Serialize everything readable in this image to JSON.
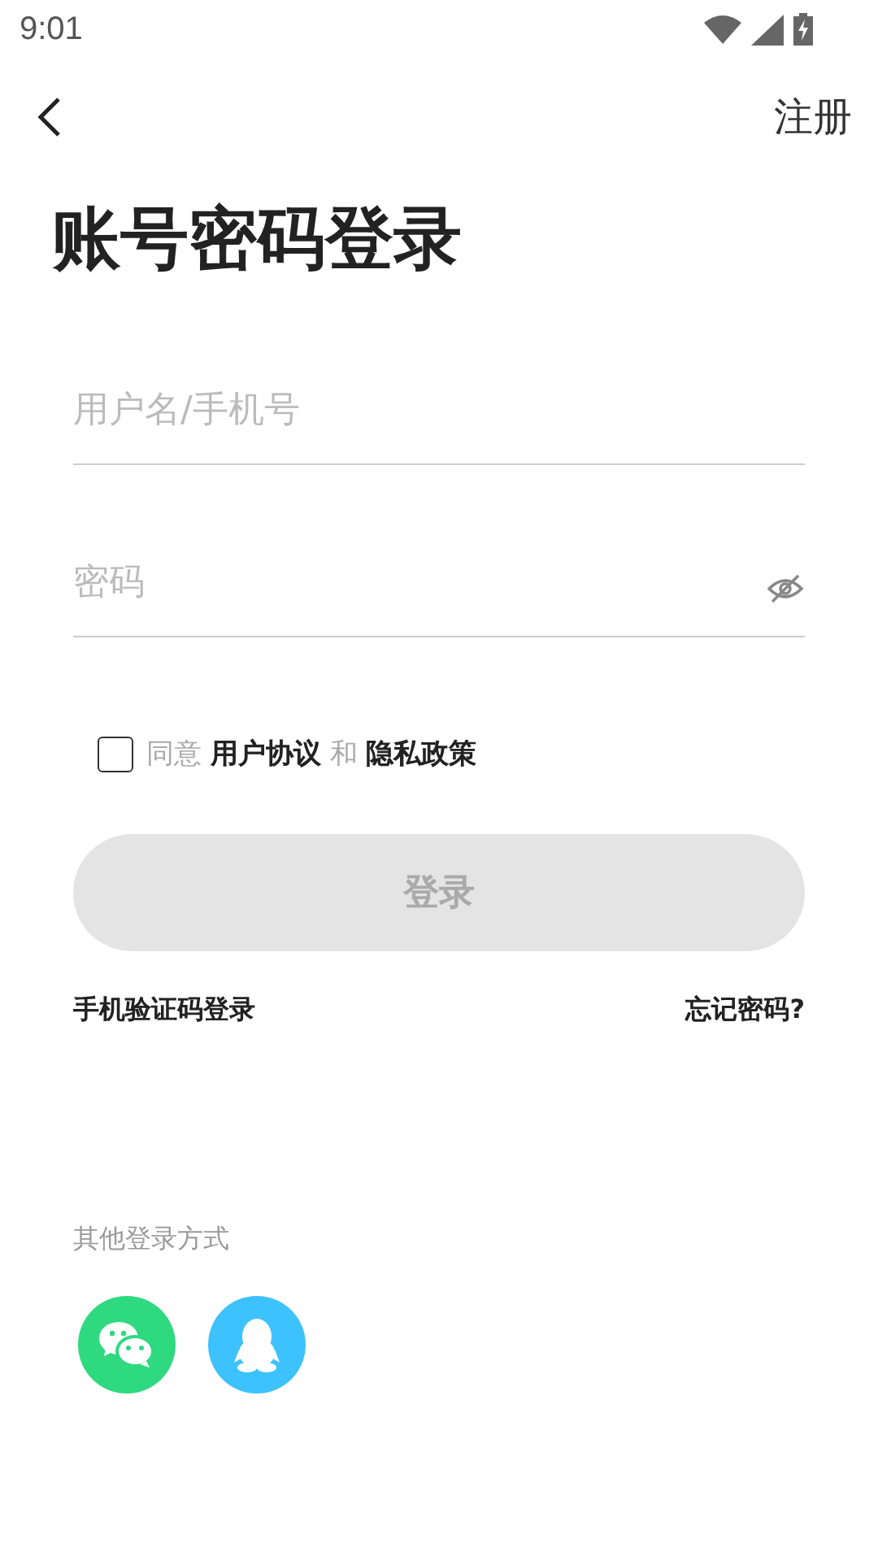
{
  "status_bar": {
    "time": "9:01"
  },
  "nav": {
    "action": "注册"
  },
  "title": "账号密码登录",
  "fields": [
    {
      "kind": "text",
      "placeholder": "用户名/手机号"
    },
    {
      "kind": "password",
      "placeholder": "密码"
    }
  ],
  "agreement": {
    "checked": false,
    "text": "同意 **用户协议** 和 **隐私政策**"
  },
  "login_button": {
    "label": "登录",
    "disabled": true
  },
  "links": [
    "手机验证码登录",
    "忘记密码?"
  ],
  "other_login": {
    "label": "其他登录方式",
    "methods": [
      {
        "kind": "wechat",
        "color": "#2fd97f"
      },
      {
        "kind": "qq",
        "color": "#3ec2fd"
      }
    ]
  }
}
